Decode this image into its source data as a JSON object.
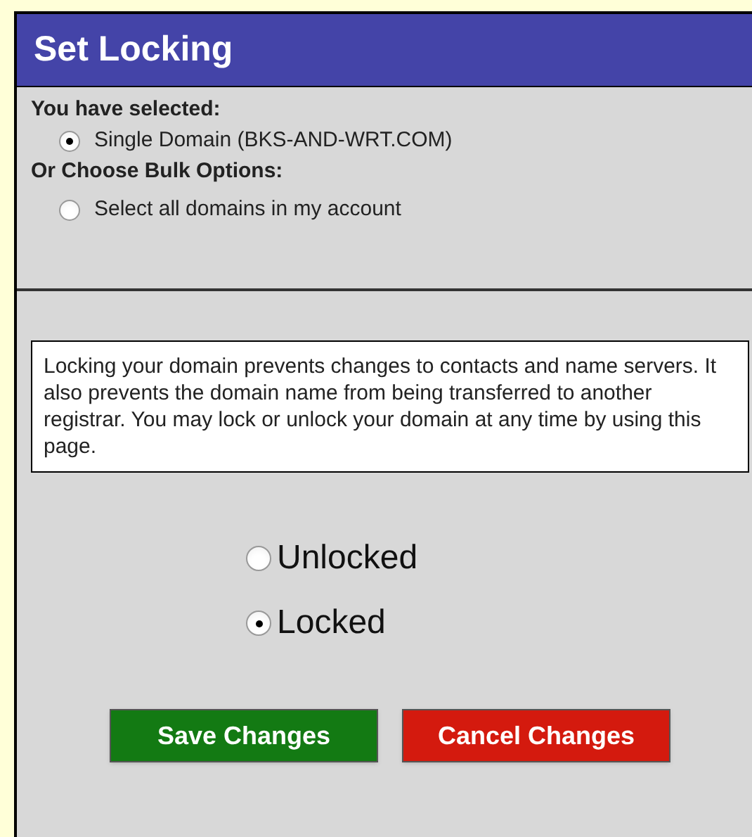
{
  "header": {
    "title": "Set Locking"
  },
  "selection": {
    "label": "You have selected:",
    "options": [
      {
        "label": "Single Domain (BKS-AND-WRT.COM)",
        "selected": true
      }
    ]
  },
  "bulk": {
    "label": "Or Choose Bulk Options:",
    "options": [
      {
        "label": "Select all domains in my account",
        "selected": false
      }
    ]
  },
  "info": "Locking your domain prevents changes to contacts and name servers. It also prevents the domain name from being transferred to another registrar. You may lock or unlock your domain at any time by using this page.",
  "lock_options": [
    {
      "label": "Unlocked",
      "selected": false
    },
    {
      "label": "Locked",
      "selected": true
    }
  ],
  "buttons": [
    {
      "label": "Save Changes",
      "kind": "save"
    },
    {
      "label": "Cancel Changes",
      "kind": "cancel"
    }
  ]
}
